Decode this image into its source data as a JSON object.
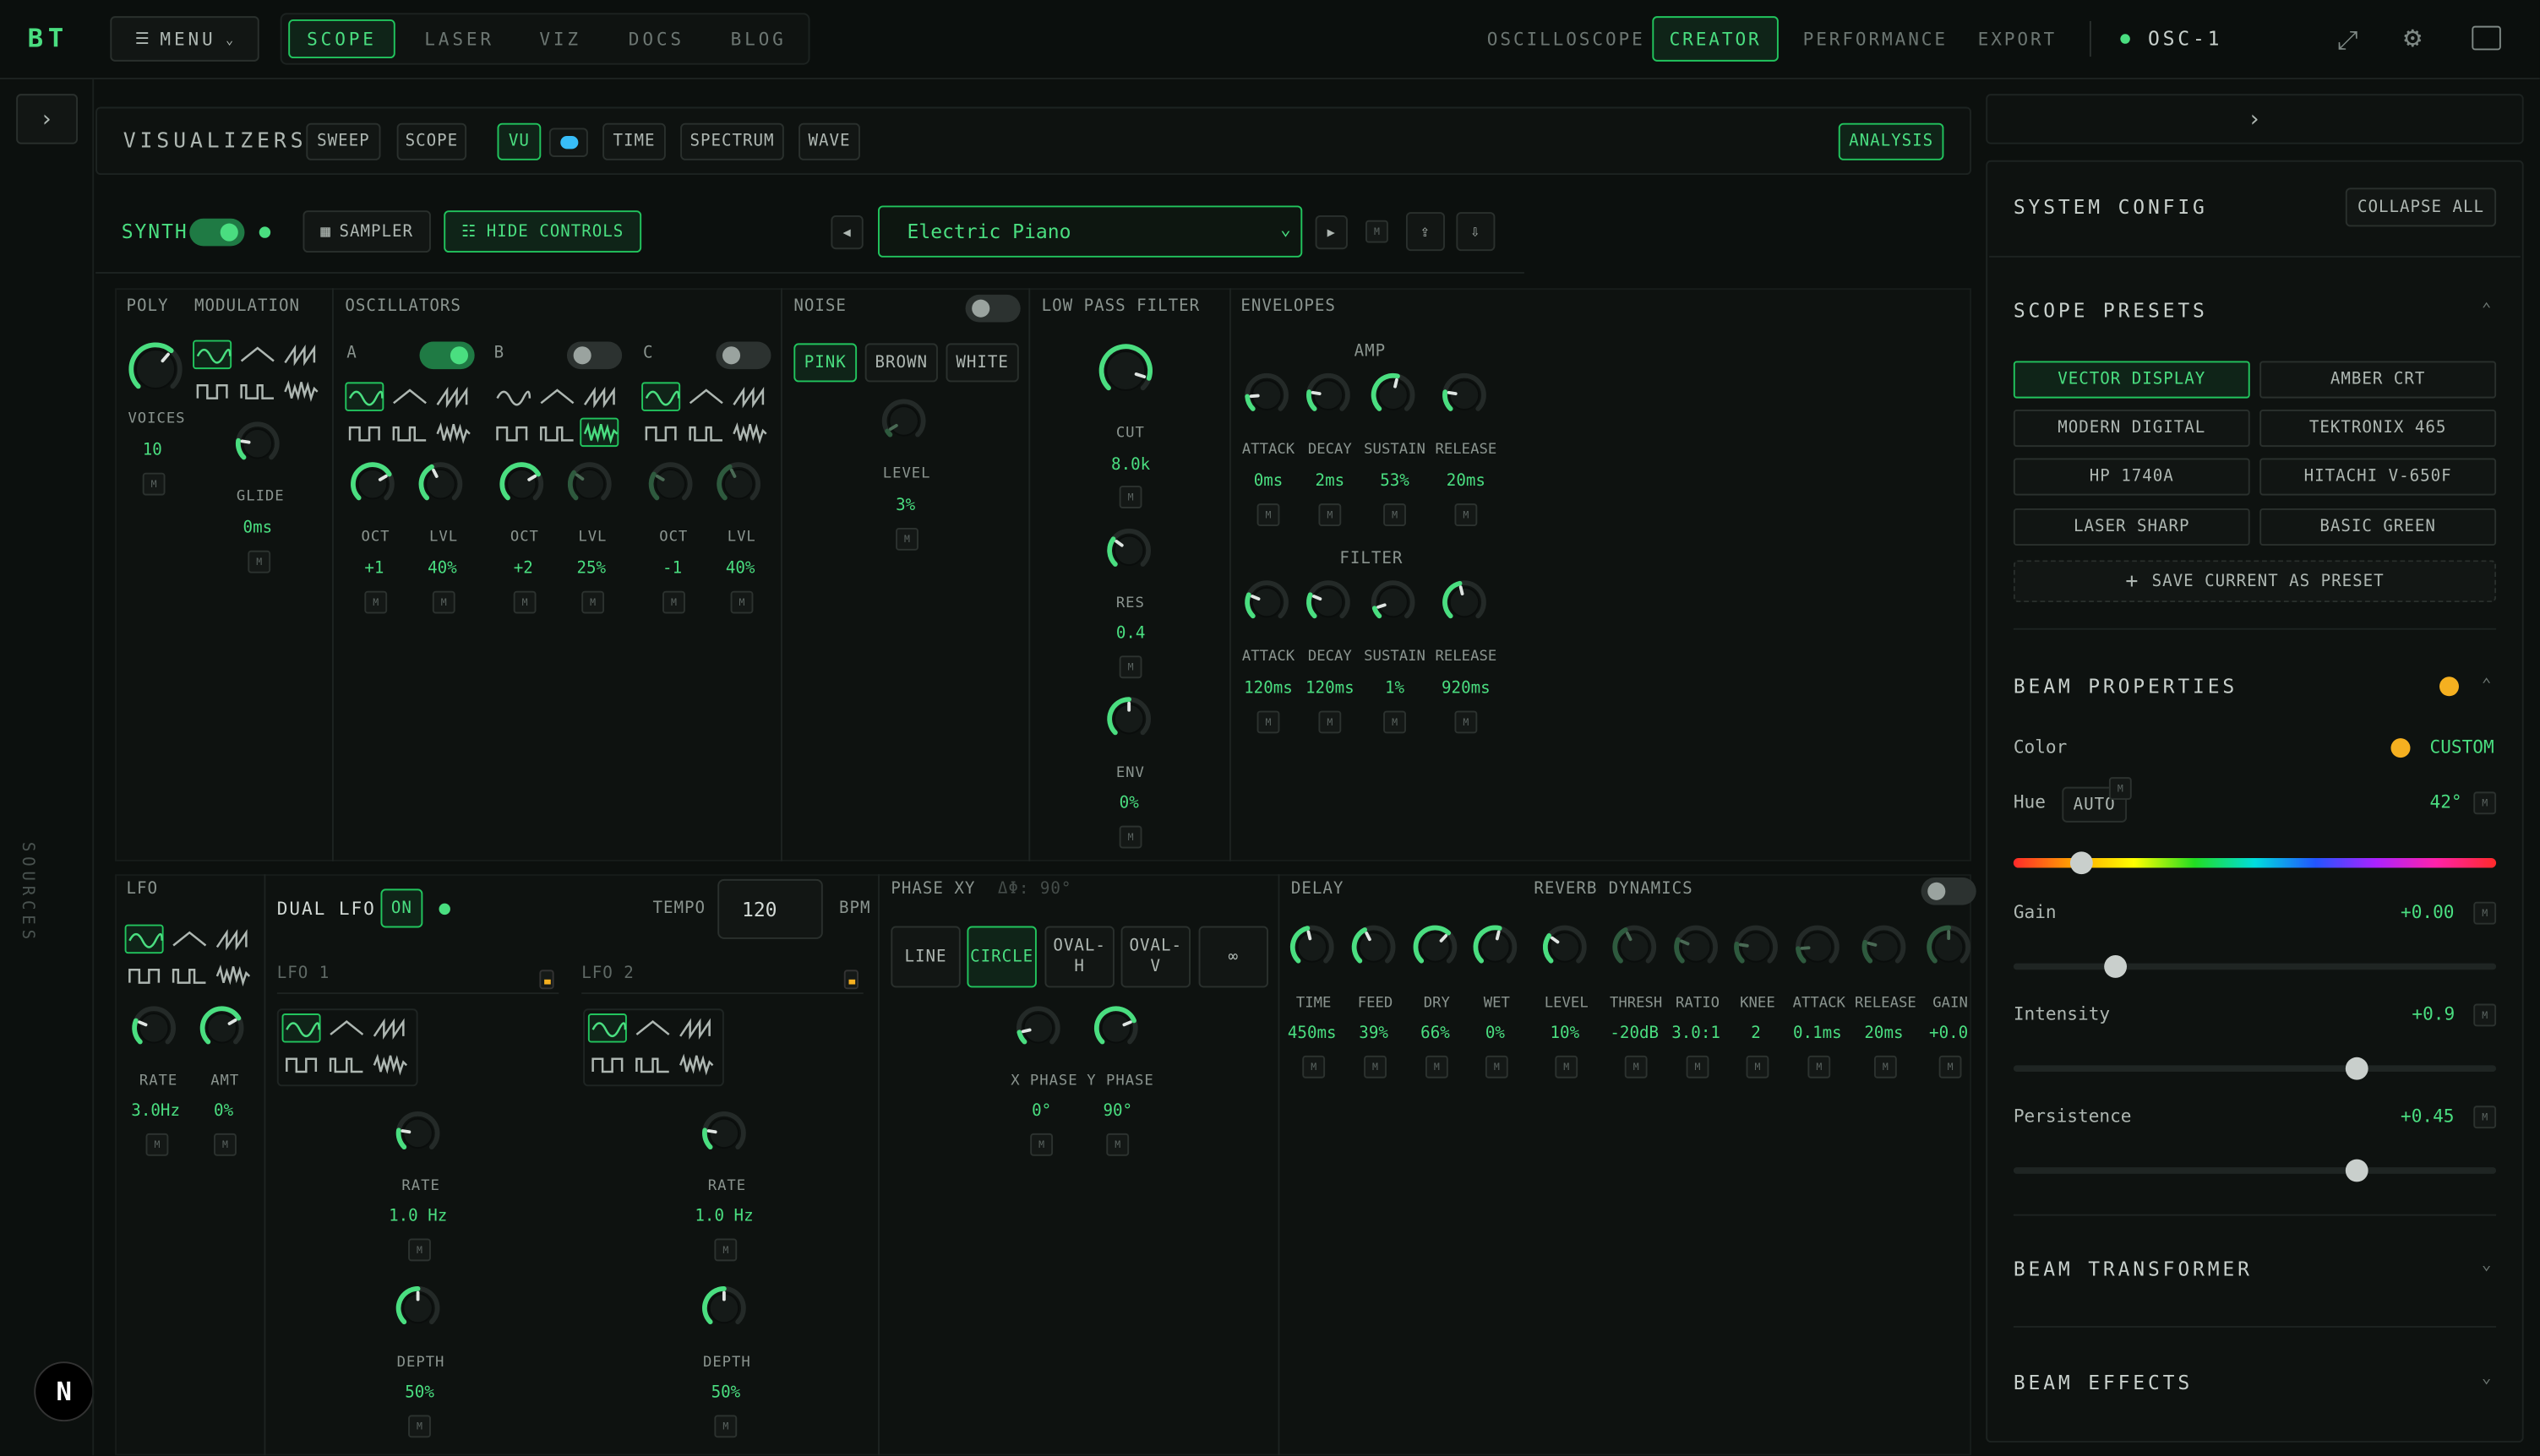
{
  "brand": "BT",
  "nav": {
    "menu_label": "MENU",
    "tabs": [
      "SCOPE",
      "LASER",
      "VIZ",
      "DOCS",
      "BLOG"
    ],
    "right_tabs": [
      "OSCILLOSCOPE",
      "CREATOR",
      "PERFORMANCE",
      "EXPORT"
    ],
    "device": "OSC-1"
  },
  "visualizers": {
    "title": "VISUALIZERS",
    "buttons": [
      "SWEEP",
      "SCOPE",
      "VU",
      "TIME",
      "SPECTRUM",
      "WAVE"
    ],
    "analysis": "ANALYSIS"
  },
  "synth": {
    "label": "SYNTH",
    "sampler": "SAMPLER",
    "hide_controls": "HIDE CONTROLS",
    "preset": "Electric Piano",
    "m": "M"
  },
  "sections": {
    "poly": "POLY",
    "modulation": "MODULATION",
    "oscillators": "OSCILLATORS",
    "noise": "NOISE",
    "lpf": "LOW PASS FILTER",
    "envelopes": "ENVELOPES",
    "amp": "AMP",
    "filter": "FILTER",
    "lfo": "LFO",
    "dual_lfo": "DUAL LFO",
    "on": "ON",
    "tempo": "TEMPO",
    "tempo_value": "120",
    "bpm": "BPM",
    "lfo1": "LFO 1",
    "lfo2": "LFO 2",
    "phase_xy": "PHASE XY",
    "phase_delta": "Δφ: 90°",
    "delay": "DELAY",
    "reverb": "REVERB",
    "dynamics": "DYNAMICS",
    "sources": "SOURCES"
  },
  "poly": {
    "voices_label": "VOICES",
    "voices": "10",
    "glide_label": "GLIDE",
    "glide": "0ms"
  },
  "osc": {
    "names": [
      "A",
      "B",
      "C"
    ],
    "oct_label": "OCT",
    "lvl_label": "LVL",
    "values": [
      [
        "+1",
        "40%"
      ],
      [
        "+2",
        "25%"
      ],
      [
        "-1",
        "40%"
      ]
    ]
  },
  "noise": {
    "buttons": [
      "PINK",
      "BROWN",
      "WHITE"
    ],
    "level_label": "LEVEL",
    "level": "3%"
  },
  "lpf": {
    "cut_label": "CUT",
    "cut": "8.0k",
    "res_label": "RES",
    "res": "0.4",
    "env_label": "ENV",
    "env": "0%"
  },
  "env": {
    "labels": [
      "ATTACK",
      "DECAY",
      "SUSTAIN",
      "RELEASE"
    ],
    "amp_values": [
      "0ms",
      "2ms",
      "53%",
      "20ms"
    ],
    "filter_values": [
      "120ms",
      "120ms",
      "1%",
      "920ms"
    ]
  },
  "lfo": {
    "rate_label": "RATE",
    "rate": "3.0Hz",
    "amt_label": "AMT",
    "amt": "0%"
  },
  "dual": {
    "rate_label": "RATE",
    "rate1": "1.0 Hz",
    "rate2": "1.0 Hz",
    "depth_label": "DEPTH",
    "depth1": "50%",
    "depth2": "50%"
  },
  "phase": {
    "buttons": [
      "LINE",
      "CIRCLE",
      "OVAL-H",
      "OVAL-V",
      "∞"
    ],
    "x_label": "X PHASE",
    "x": "0°",
    "y_label": "Y PHASE",
    "y": "90°"
  },
  "fx": {
    "labels": [
      "TIME",
      "FEED",
      "DRY",
      "WET",
      "LEVEL",
      "THRESH",
      "RATIO",
      "KNEE",
      "ATTACK",
      "RELEASE",
      "GAIN"
    ],
    "values": [
      "450ms",
      "39%",
      "66%",
      "0%",
      "10%",
      "-20dB",
      "3.0:1",
      "2",
      "0.1ms",
      "20ms",
      "+0.0"
    ]
  },
  "side": {
    "system_config": "SYSTEM CONFIG",
    "collapse_all": "COLLAPSE ALL",
    "scope_presets": "SCOPE PRESETS",
    "presets": [
      "VECTOR DISPLAY",
      "AMBER CRT",
      "MODERN DIGITAL",
      "TEKTRONIX 465",
      "HP 1740A",
      "HITACHI V-650F",
      "LASER SHARP",
      "BASIC GREEN"
    ],
    "save_preset": "SAVE CURRENT AS PRESET",
    "beam_properties": "BEAM PROPERTIES",
    "color_label": "Color",
    "color_value": "CUSTOM",
    "hue_label": "Hue",
    "auto": "AUTO",
    "hue_value": "42°",
    "hue_fraction": 0.14,
    "gain_label": "Gain",
    "gain_value": "+0.00",
    "gain_fraction": 0.21,
    "intensity_label": "Intensity",
    "intensity_value": "+0.9",
    "intensity_fraction": 0.71,
    "persistence_label": "Persistence",
    "persistence_value": "+0.45",
    "persistence_fraction": 0.71,
    "beam_transformer": "BEAM TRANSFORMER",
    "beam_effects": "BEAM EFFECTS"
  },
  "colors": {
    "accent": "#4ade80",
    "amber": "#f5b020",
    "panel": "#0e1210"
  }
}
